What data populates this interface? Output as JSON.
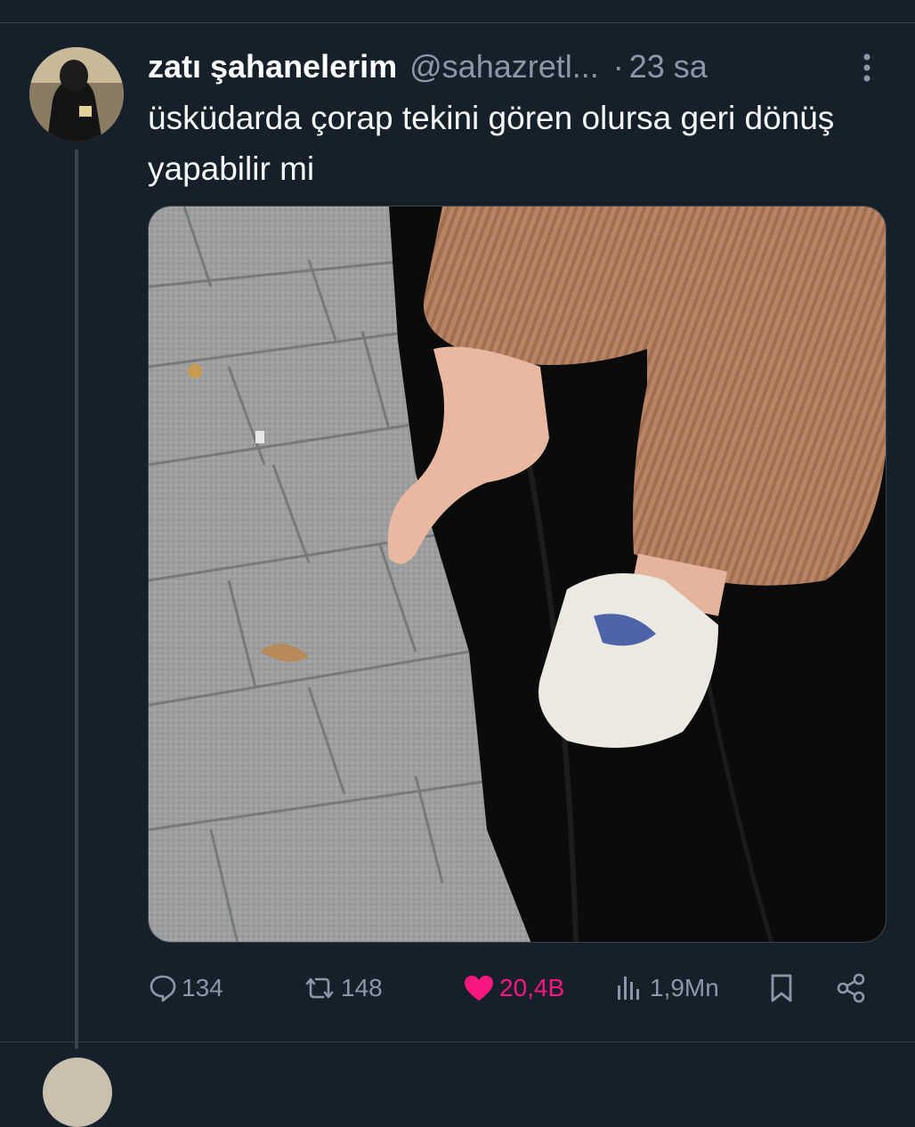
{
  "tweet": {
    "display_name": "zatı şahanelerim",
    "handle": "@sahazretl...",
    "separator": "·",
    "time": "23 sa",
    "text": "üsküdarda çorap tekini gören olursa geri dönüş yapabilir mi"
  },
  "actions": {
    "replies": "134",
    "retweets": "148",
    "likes": "20,4B",
    "views": "1,9Mn"
  },
  "colors": {
    "background": "#15202b",
    "like_active": "#f91880",
    "secondary_text": "#8b98a5"
  },
  "icons": [
    "more-icon",
    "reply-icon",
    "retweet-icon",
    "like-icon",
    "views-icon",
    "bookmark-icon",
    "share-icon"
  ]
}
